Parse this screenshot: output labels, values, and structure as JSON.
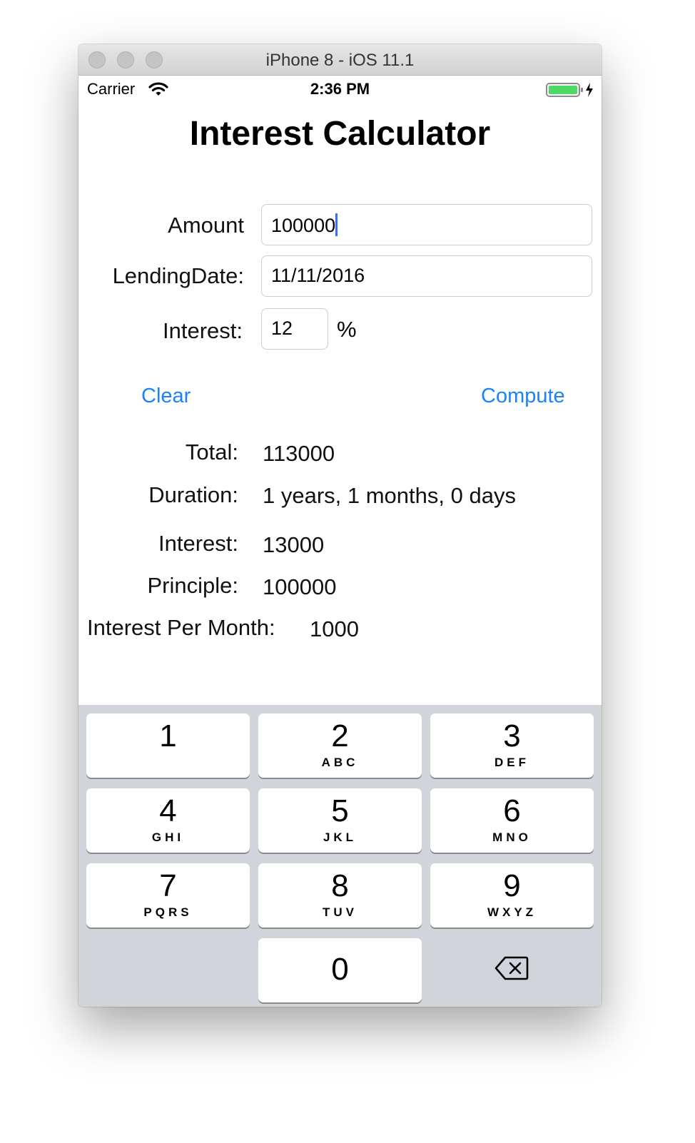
{
  "window": {
    "title": "iPhone 8 - iOS 11.1"
  },
  "status_bar": {
    "carrier": "Carrier",
    "time": "2:36 PM",
    "icons": [
      "wifi-icon",
      "battery-icon",
      "charging-bolt-icon"
    ],
    "battery_color": "#4cd964"
  },
  "app": {
    "title": "Interest Calculator"
  },
  "form": {
    "amount_label": "Amount",
    "amount_value": "100000",
    "lending_date_label": "LendingDate:",
    "lending_date_value": "11/11/2016",
    "interest_label": "Interest:",
    "interest_value": "12",
    "percent_sign": "%"
  },
  "actions": {
    "clear_label": "Clear",
    "compute_label": "Compute",
    "accent_color": "#1a82fb"
  },
  "results": {
    "total_label": "Total:",
    "total_value": "113000",
    "duration_label": "Duration:",
    "duration_value": "1 years, 1 months, 0 days",
    "interest_label": "Interest:",
    "interest_value": "13000",
    "principle_label": "Principle:",
    "principle_value": "100000",
    "per_month_label": "Interest Per Month:",
    "per_month_value": "1000"
  },
  "keypad": {
    "keys": [
      {
        "digit": "1",
        "letters": ""
      },
      {
        "digit": "2",
        "letters": "ABC"
      },
      {
        "digit": "3",
        "letters": "DEF"
      },
      {
        "digit": "4",
        "letters": "GHI"
      },
      {
        "digit": "5",
        "letters": "JKL"
      },
      {
        "digit": "6",
        "letters": "MNO"
      },
      {
        "digit": "7",
        "letters": "PQRS"
      },
      {
        "digit": "8",
        "letters": "TUV"
      },
      {
        "digit": "9",
        "letters": "WXYZ"
      },
      {
        "digit": "0",
        "letters": ""
      }
    ],
    "delete_icon": "delete-backspace-icon"
  }
}
